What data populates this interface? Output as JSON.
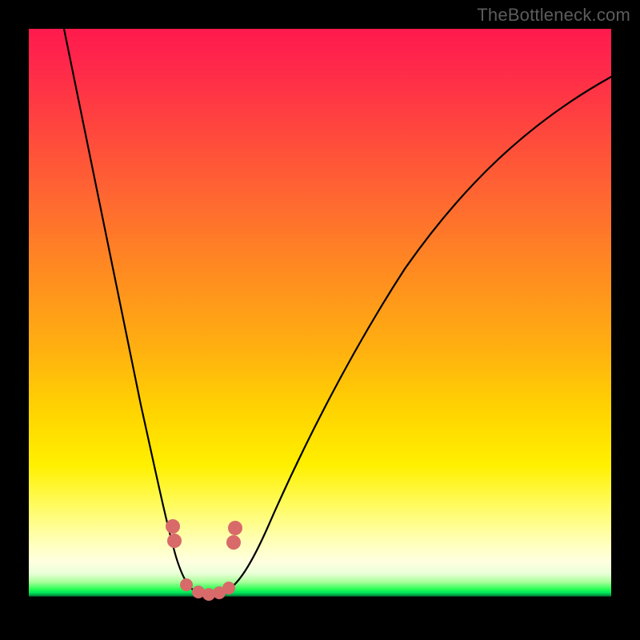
{
  "watermark": "TheBottleneck.com",
  "chart_data": {
    "type": "line",
    "title": "",
    "xlabel": "",
    "ylabel": "",
    "xlim": [
      0,
      100
    ],
    "ylim": [
      0,
      100
    ],
    "note": "Bottleneck curve: y≈0 (green) at the minimum ~x=30, rising steeply (red) either side. Values estimated from color bands; no axis ticks shown.",
    "series": [
      {
        "name": "bottleneck-curve",
        "color": "#000000",
        "x": [
          6,
          10,
          14,
          18,
          22,
          25,
          27,
          29,
          30,
          31,
          33,
          35,
          38,
          45,
          55,
          65,
          75,
          85,
          95,
          100
        ],
        "values": [
          100,
          85,
          68,
          50,
          30,
          14,
          6,
          1,
          0,
          0,
          1,
          5,
          11,
          25,
          42,
          55,
          65,
          73,
          79,
          82
        ]
      }
    ],
    "markers": {
      "name": "highlighted-points",
      "color": "#d86a6a",
      "points": [
        {
          "x": 25.0,
          "y": 14
        },
        {
          "x": 25.2,
          "y": 12
        },
        {
          "x": 27.5,
          "y": 3
        },
        {
          "x": 29.0,
          "y": 0.5
        },
        {
          "x": 30.5,
          "y": 0
        },
        {
          "x": 31.8,
          "y": 0.5
        },
        {
          "x": 33.0,
          "y": 2
        },
        {
          "x": 34.5,
          "y": 9
        },
        {
          "x": 34.8,
          "y": 12
        }
      ]
    },
    "gradient_bands": [
      {
        "label": "red",
        "y_pct": 100
      },
      {
        "label": "orange",
        "y_pct": 55
      },
      {
        "label": "yellow",
        "y_pct": 25
      },
      {
        "label": "cream",
        "y_pct": 10
      },
      {
        "label": "green",
        "y_pct": 4
      },
      {
        "label": "black",
        "y_pct": 2
      }
    ]
  }
}
